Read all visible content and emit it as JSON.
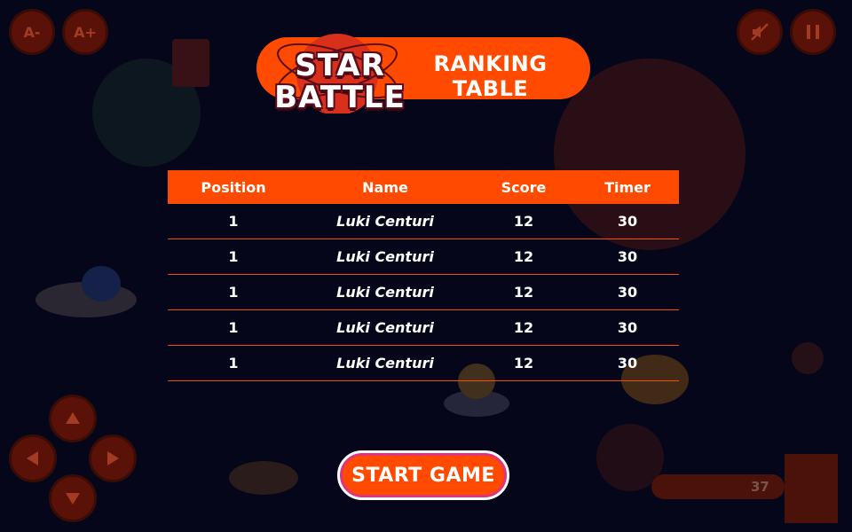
{
  "colors": {
    "accent": "#ff4a00",
    "background": "#05061a",
    "button_border": "#ffffff",
    "button_inner_ring": "#e0337a",
    "table_divider": "#ff4a00"
  },
  "top_left_controls": [
    {
      "label": "A-",
      "icon": "font-decrease-icon"
    },
    {
      "label": "A+",
      "icon": "font-increase-icon"
    }
  ],
  "top_right_controls": [
    {
      "icon": "mute-icon"
    },
    {
      "icon": "pause-icon"
    }
  ],
  "logo": {
    "line1": "STAR",
    "line2": "BATTLE"
  },
  "header": {
    "title": "RANKING TABLE"
  },
  "table": {
    "columns": [
      "Position",
      "Name",
      "Score",
      "Timer"
    ],
    "rows": [
      {
        "position": "1",
        "name": "Luki Centuri",
        "score": "12",
        "timer": "30"
      },
      {
        "position": "1",
        "name": "Luki Centuri",
        "score": "12",
        "timer": "30"
      },
      {
        "position": "1",
        "name": "Luki Centuri",
        "score": "12",
        "timer": "30"
      },
      {
        "position": "1",
        "name": "Luki Centuri",
        "score": "12",
        "timer": "30"
      },
      {
        "position": "1",
        "name": "Luki Centuri",
        "score": "12",
        "timer": "30"
      }
    ]
  },
  "start_button": {
    "label": "START GAME"
  },
  "hud": {
    "counter": "37"
  },
  "dpad": [
    "arrow-up-icon",
    "arrow-left-icon",
    "arrow-right-icon",
    "arrow-down-icon"
  ]
}
